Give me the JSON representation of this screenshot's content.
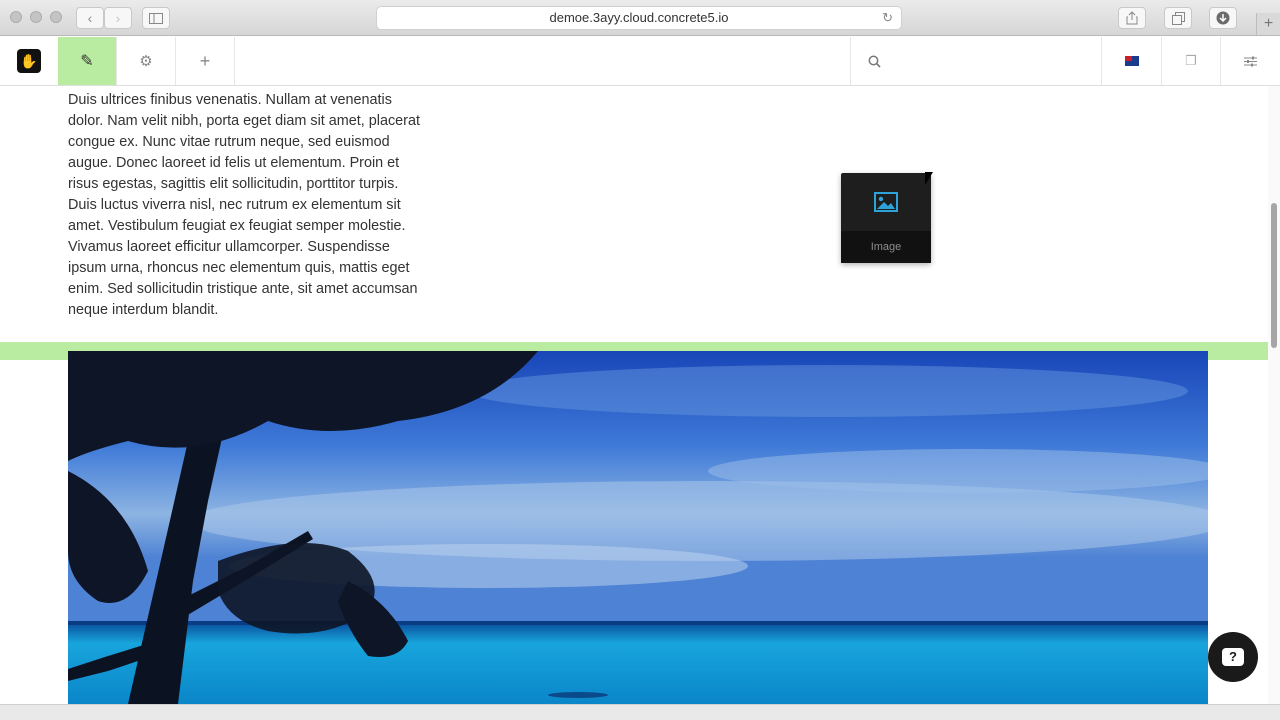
{
  "browser": {
    "url": "demoe.3ayy.cloud.concrete5.io",
    "back_glyph": "‹",
    "forward_glyph": "›",
    "reload_glyph": "↻",
    "new_tab_glyph": "+",
    "icons": [
      "sidebar-icon",
      "share-icon",
      "tabs-icon",
      "download-icon"
    ]
  },
  "toolbar": {
    "logo_glyph": "✋",
    "edit_glyph": "✎",
    "settings_glyph": "⚙",
    "add_glyph": "+",
    "search_glyph": "⌕",
    "pages_glyph": "❐",
    "sliders_glyph": "≡",
    "edit_active_color": "#b9eba0"
  },
  "content": {
    "paragraph": "Duis ultrices finibus venenatis. Nullam at venenatis dolor. Nam velit nibh, porta eget diam sit amet, placerat congue ex. Nunc vitae rutrum neque, sed euismod augue. Donec laoreet id felis ut elementum. Proin et risus egestas, sagittis elit sollicitudin, porttitor turpis. Duis luctus viverra nisl, nec rutrum ex elementum sit amet. Vestibulum feugiat ex feugiat semper molestie. Vivamus laoreet efficitur ullamcorper. Suspendisse ipsum urna, rhoncus nec elementum quis, mattis eget enim. Sed sollicitudin tristique ante, sit amet accumsan neque interdum blandit."
  },
  "drag_block": {
    "label": "Image",
    "icon": "image-icon"
  },
  "help": {
    "glyph": "?"
  }
}
